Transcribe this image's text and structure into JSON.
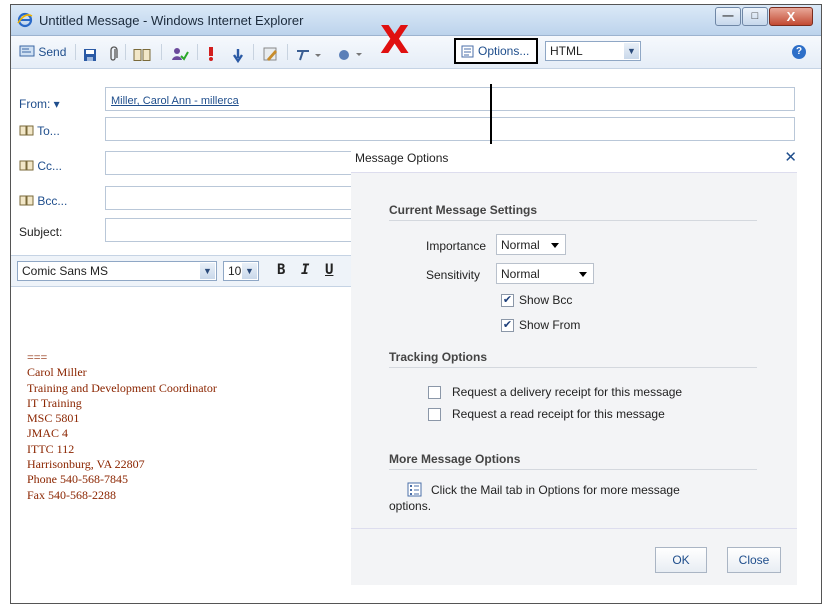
{
  "window": {
    "title": "Untitled Message - Windows Internet Explorer",
    "min": "—",
    "max": "□",
    "close": "X"
  },
  "toolbar": {
    "send_label": "Send",
    "options_label": "Options...",
    "format_value": "HTML"
  },
  "header": {
    "from_label": "From: ▾",
    "from_value": "Miller, Carol Ann - millerca",
    "to_label": "To...",
    "cc_label": "Cc...",
    "bcc_label": "Bcc...",
    "subject_label": "Subject:"
  },
  "format": {
    "font": "Comic Sans MS",
    "size": "10",
    "bold": "B",
    "italic": "I",
    "underline": "U"
  },
  "signature": [
    "===",
    "Carol Miller",
    "Training and Development Coordinator",
    "IT Training",
    "MSC 5801",
    "JMAC 4",
    "ITTC 112",
    "Harrisonburg, VA 22807",
    "Phone 540-568-7845",
    "Fax  540-568-2288"
  ],
  "dialog": {
    "title": "Message Options",
    "close": "✕",
    "current_heading": "Current Message Settings",
    "importance_label": "Importance",
    "importance_value": "Normal",
    "sensitivity_label": "Sensitivity",
    "sensitivity_value": "Normal",
    "show_bcc": "Show Bcc",
    "show_from": "Show From",
    "tracking_heading": "Tracking Options",
    "delivery_receipt": "Request a delivery receipt for this message",
    "read_receipt": "Request a read receipt for this message",
    "more_heading": "More Message Options",
    "more_text_1": "Click the Mail tab in Options for more message",
    "more_text_2": "options.",
    "ok": "OK",
    "close_btn": "Close"
  },
  "colors": {
    "link": "#1f4e8c",
    "signature": "#8b2500",
    "annotation_x": "#e01010"
  }
}
